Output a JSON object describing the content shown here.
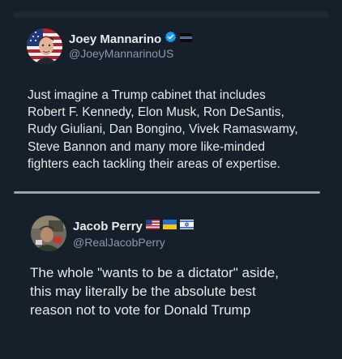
{
  "quoted_tweet": {
    "display_name": "Joey Mannarino",
    "handle": "@JoeyMannarinoUS",
    "text": "Just imagine a Trump cabinet that includes\nRobert F. Kennedy, Elon Musk, Ron DeSantis,\nRudy Giuliani, Dan Bongino, Vivek Ramaswamy,\nSteve Bannon and many more like-minded\nfighters each tackling their areas of expertise.",
    "icons": [
      "verified-badge-icon",
      "thin-blue-line-flag-icon"
    ]
  },
  "reply_tweet": {
    "display_name": "Jacob Perry",
    "handle": "@RealJacobPerry",
    "text": "The whole \"wants to be a dictator\" aside,\nthis may literally be the absolute best\nreason not to vote for Donald Trump",
    "icons": [
      "us-flag-icon",
      "ukraine-flag-icon",
      "israel-flag-icon"
    ]
  },
  "colors": {
    "background": "#15202b",
    "text": "#e7e9ea",
    "secondary_text": "#8b98a5",
    "verified_blue": "#1d9bf0"
  }
}
